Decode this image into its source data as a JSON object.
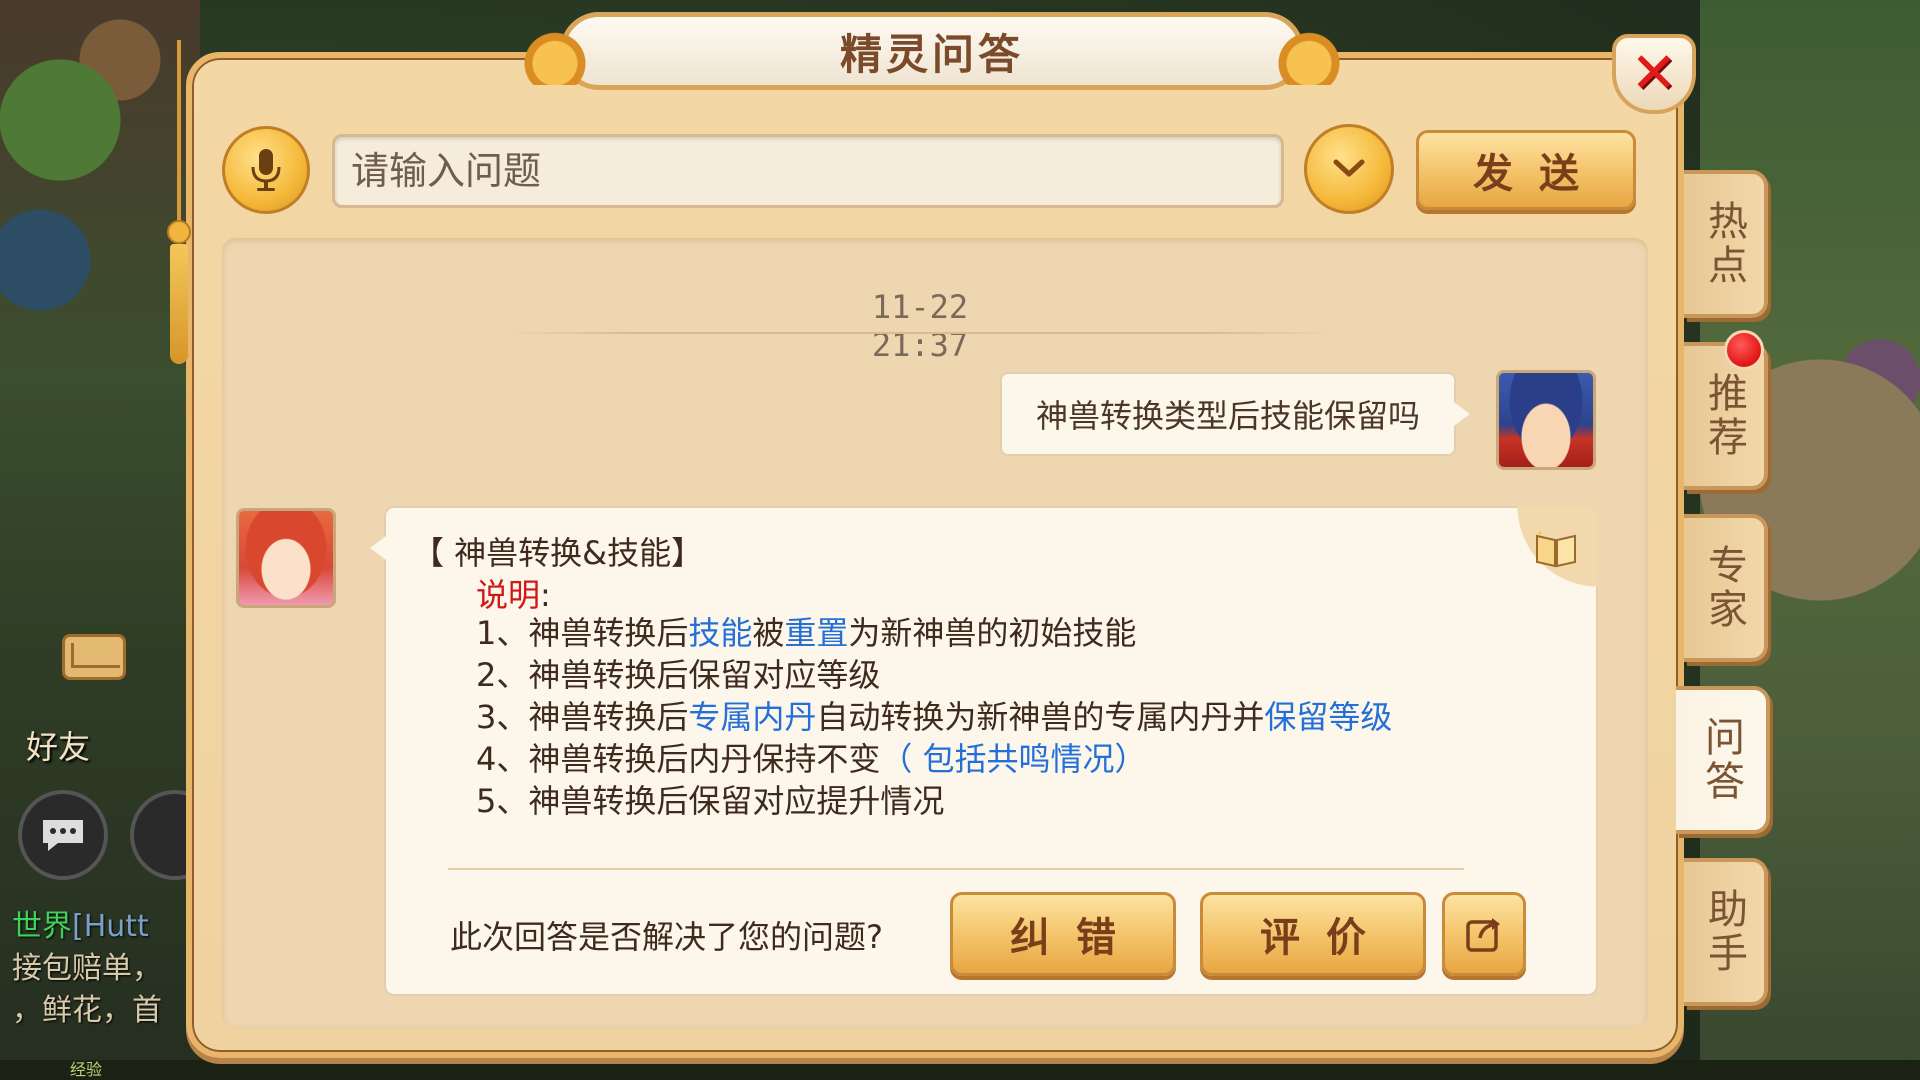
{
  "dialog": {
    "title": "精灵问答",
    "close_symbol": "✕"
  },
  "input": {
    "placeholder": "请输入问题",
    "value": "",
    "send_label": "发送"
  },
  "side_tabs": [
    {
      "label": "热点",
      "active": false
    },
    {
      "label": "推荐",
      "active": false,
      "notification": true
    },
    {
      "label": "专家",
      "active": false
    },
    {
      "label": "问答",
      "active": true
    },
    {
      "label": "助手",
      "active": false
    }
  ],
  "conversation": {
    "timestamp": "11-22 21:37",
    "user_message": "神兽转换类型后技能保留吗",
    "answer": {
      "title": "【 神兽转换&技能】",
      "label": "说明",
      "label_colon": ":",
      "items": [
        {
          "prefix": "1、神兽转换后",
          "hl1": "技能",
          "mid1": "被",
          "hl2": "重置",
          "rest": "为新神兽的初始技能"
        },
        {
          "text": "2、神兽转换后保留对应等级"
        },
        {
          "prefix": "3、神兽转换后",
          "hl1": "专属内丹",
          "mid1": "自动转换为新神兽的专属内丹并",
          "hl2": "保留等级"
        },
        {
          "prefix": "4、神兽转换后内丹保持不变",
          "hl1": "（ 包括共鸣情况）"
        },
        {
          "text": "5、神兽转换后保留对应提升情况"
        }
      ]
    },
    "feedback": {
      "question": "此次回答是否解决了您的问题?",
      "correct_label": "纠错",
      "rate_label": "评价"
    }
  },
  "background_hud": {
    "friend_label": "好友",
    "world_chat": {
      "tag": "世界",
      "name": "[Hutt",
      "line2": "接包赔单，",
      "line3": "，鲜花，首"
    },
    "exp_label": "经验"
  },
  "colors": {
    "accent_gold": "#f4c56c",
    "highlight_blue": "#2470d8",
    "label_red": "#d01818",
    "close_red": "#e01a1a"
  },
  "icons": {
    "mic": "microphone-icon",
    "dropdown": "chevron-down-icon",
    "share": "share-icon",
    "close": "close-icon",
    "book": "book-icon"
  }
}
